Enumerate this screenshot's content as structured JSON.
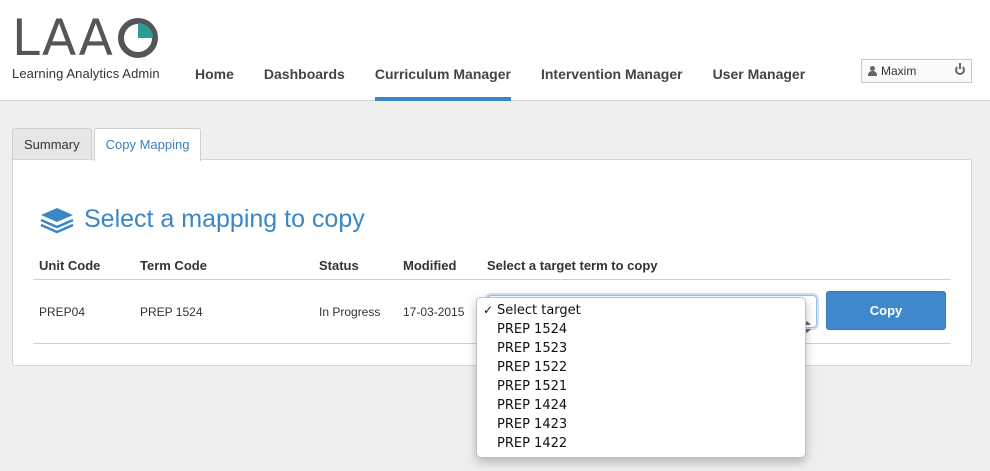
{
  "app": {
    "logo_text": "LAA",
    "subtitle": "Learning Analytics Admin",
    "colors": {
      "accent": "#3a86c8",
      "logo_slice": "#2a9d9a",
      "button": "#3f88cc"
    }
  },
  "nav": {
    "items": [
      {
        "label": "Home",
        "active": false
      },
      {
        "label": "Dashboards",
        "active": false
      },
      {
        "label": "Curriculum Manager",
        "active": true
      },
      {
        "label": "Intervention Manager",
        "active": false
      },
      {
        "label": "User Manager",
        "active": false
      }
    ]
  },
  "user": {
    "name": "Maxim",
    "icon": "user-icon",
    "logout_icon": "power-icon"
  },
  "tabs": [
    {
      "label": "Summary",
      "active": false
    },
    {
      "label": "Copy Mapping",
      "active": true
    }
  ],
  "panel": {
    "title": "Select a mapping to copy",
    "title_icon": "layers-icon"
  },
  "table": {
    "headers": [
      "Unit Code",
      "Term Code",
      "Status",
      "Modified",
      "Select a target term to copy"
    ],
    "rows": [
      {
        "unit_code": "PREP04",
        "term_code": "PREP 1524",
        "status": "In Progress",
        "modified": "17-03-2015",
        "action_label": "Copy"
      }
    ]
  },
  "dropdown": {
    "selected": "Select target",
    "options": [
      "Select target",
      "PREP 1524",
      "PREP 1523",
      "PREP 1522",
      "PREP 1521",
      "PREP 1424",
      "PREP 1423",
      "PREP 1422"
    ],
    "check_mark": "✓"
  }
}
